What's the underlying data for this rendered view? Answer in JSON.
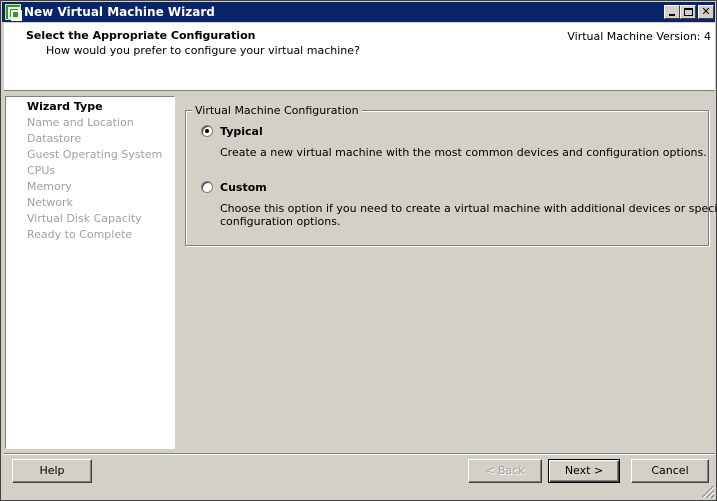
{
  "window": {
    "title": "New Virtual Machine Wizard"
  },
  "header": {
    "title": "Select the Appropriate Configuration",
    "subtitle": "How would you prefer to configure your virtual machine?",
    "version": "Virtual Machine Version: 4"
  },
  "nav": {
    "items": [
      {
        "label": "Wizard Type",
        "active": true
      },
      {
        "label": "Name and Location",
        "active": false
      },
      {
        "label": "Datastore",
        "active": false
      },
      {
        "label": "Guest Operating System",
        "active": false
      },
      {
        "label": "CPUs",
        "active": false
      },
      {
        "label": "Memory",
        "active": false
      },
      {
        "label": "Network",
        "active": false
      },
      {
        "label": "Virtual Disk Capacity",
        "active": false
      },
      {
        "label": "Ready to Complete",
        "active": false
      }
    ]
  },
  "config": {
    "legend": "Virtual Machine Configuration",
    "selected": "typical",
    "typical": {
      "label": "Typical",
      "description": "Create a new virtual machine with the most common devices and configuration options."
    },
    "custom": {
      "label": "Custom",
      "description_line1": "Choose this option if you need to create a virtual machine with additional devices or specific",
      "description_line2": "configuration options."
    }
  },
  "footer": {
    "help_label": "Help",
    "back_label": "< Back",
    "next_label": "Next >",
    "cancel_label": "Cancel"
  }
}
